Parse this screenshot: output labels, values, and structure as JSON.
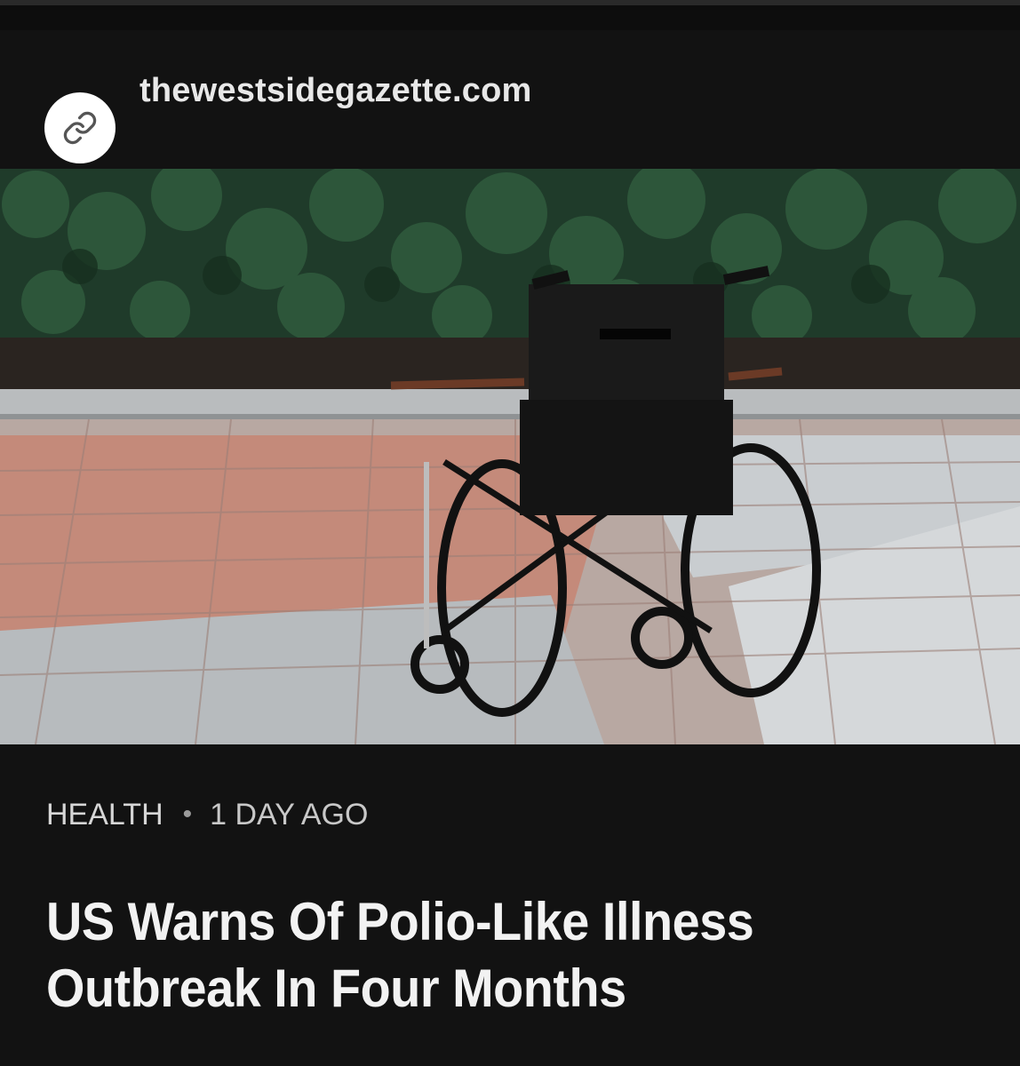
{
  "source": {
    "icon": "link-icon",
    "domain": "thewestsidegazette.com"
  },
  "hero_image": {
    "subject": "wheelchair-photo"
  },
  "article": {
    "category": "HEALTH",
    "separator": "•",
    "time_ago": "1 DAY AGO",
    "headline": "US Warns Of Polio-Like Illness Outbreak In Four Months"
  },
  "colors": {
    "background": "#121212",
    "text_primary": "#f2f2f2",
    "text_secondary": "#d6d6d6"
  }
}
